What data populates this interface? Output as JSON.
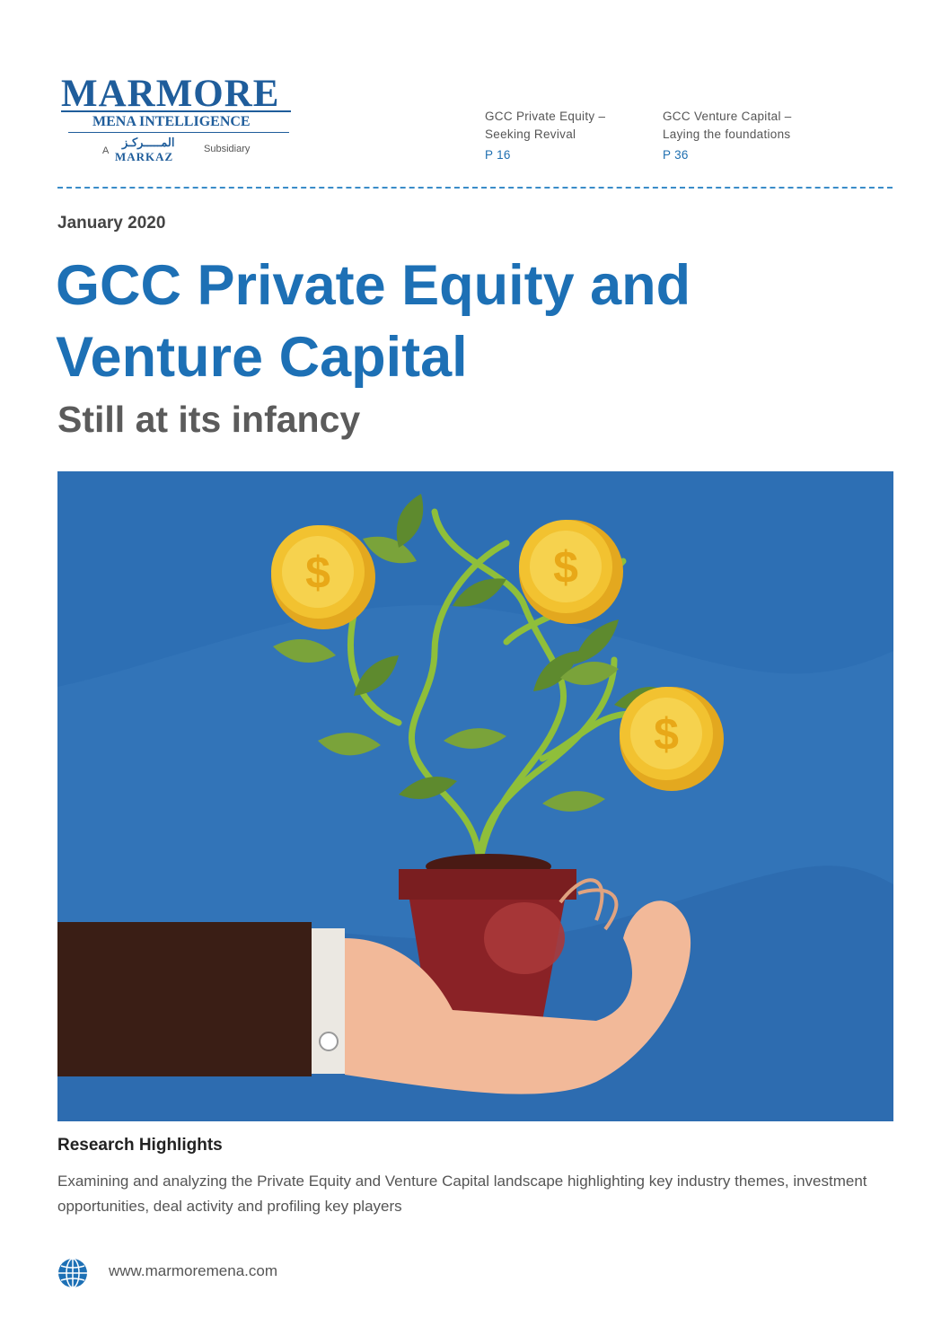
{
  "logo": {
    "wordmark": "MARMORE",
    "tagline": "MENA INTELLIGENCE",
    "prefix": "A",
    "parent_arabic": "المـــــركـز",
    "parent": "MARKAZ",
    "suffix": "Subsidiary"
  },
  "toc": [
    {
      "line1": "GCC Private Equity –",
      "line2": "Seeking Revival",
      "page": "P 16"
    },
    {
      "line1": "GCC Venture Capital –",
      "line2": "Laying the foundations",
      "page": "P 36"
    }
  ],
  "date": "January 2020",
  "title_line1": "GCC Private Equity and",
  "title_line2": "Venture Capital",
  "subtitle": "Still at its infancy",
  "colors": {
    "accent": "#1d70b5",
    "hero_bg": "#2d6fb4",
    "coin": "#f2c230",
    "leaf": "#5e8a2e",
    "pot": "#8a2226",
    "sleeve": "#3a1e15"
  },
  "highlights": {
    "heading": "Research Highlights",
    "body": "Examining and analyzing the Private Equity and Venture Capital landscape highlighting key industry themes, investment opportunities, deal activity and profiling key players"
  },
  "footer": {
    "icon": "globe-icon",
    "url": "www.marmoremena.com"
  }
}
